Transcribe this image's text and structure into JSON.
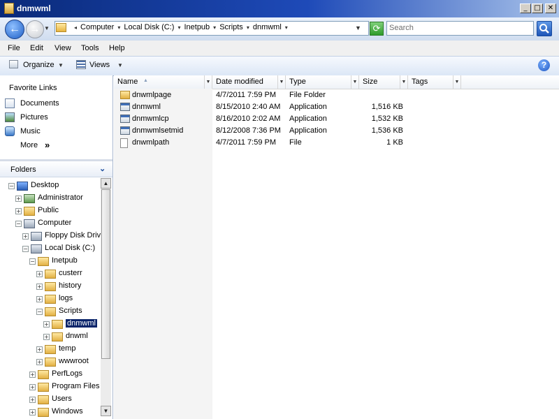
{
  "window": {
    "title": "dnmwml"
  },
  "address": {
    "crumbs": [
      "Computer",
      "Local Disk (C:)",
      "Inetpub",
      "Scripts",
      "dnmwml"
    ],
    "search_placeholder": "Search"
  },
  "menu": [
    "File",
    "Edit",
    "View",
    "Tools",
    "Help"
  ],
  "toolbar": {
    "organize": "Organize",
    "views": "Views"
  },
  "favorites": {
    "title": "Favorite Links",
    "items": [
      "Documents",
      "Pictures",
      "Music"
    ],
    "more": "More",
    "more_glyph": "»"
  },
  "folders": {
    "title": "Folders",
    "tree": [
      {
        "label": "Desktop",
        "depth": 0,
        "toggle": "−",
        "icon": "desktop"
      },
      {
        "label": "Administrator",
        "depth": 1,
        "toggle": "+",
        "icon": "user"
      },
      {
        "label": "Public",
        "depth": 1,
        "toggle": "+",
        "icon": "folder"
      },
      {
        "label": "Computer",
        "depth": 1,
        "toggle": "−",
        "icon": "computer"
      },
      {
        "label": "Floppy Disk Drive",
        "depth": 2,
        "toggle": "+",
        "icon": "floppy"
      },
      {
        "label": "Local Disk (C:)",
        "depth": 2,
        "toggle": "−",
        "icon": "disk"
      },
      {
        "label": "Inetpub",
        "depth": 3,
        "toggle": "−",
        "icon": "folder"
      },
      {
        "label": "custerr",
        "depth": 4,
        "toggle": "+",
        "icon": "folder"
      },
      {
        "label": "history",
        "depth": 4,
        "toggle": "+",
        "icon": "folder"
      },
      {
        "label": "logs",
        "depth": 4,
        "toggle": "+",
        "icon": "folder"
      },
      {
        "label": "Scripts",
        "depth": 4,
        "toggle": "−",
        "icon": "folder"
      },
      {
        "label": "dnmwml",
        "depth": 5,
        "toggle": "+",
        "icon": "folder",
        "selected": true
      },
      {
        "label": "dnwml",
        "depth": 5,
        "toggle": "+",
        "icon": "folder"
      },
      {
        "label": "temp",
        "depth": 4,
        "toggle": "+",
        "icon": "folder"
      },
      {
        "label": "wwwroot",
        "depth": 4,
        "toggle": "+",
        "icon": "folder"
      },
      {
        "label": "PerfLogs",
        "depth": 3,
        "toggle": "+",
        "icon": "folder"
      },
      {
        "label": "Program Files",
        "depth": 3,
        "toggle": "+",
        "icon": "folder"
      },
      {
        "label": "Users",
        "depth": 3,
        "toggle": "+",
        "icon": "folder"
      },
      {
        "label": "Windows",
        "depth": 3,
        "toggle": "+",
        "icon": "folder"
      }
    ]
  },
  "columns": [
    "Name",
    "Date modified",
    "Type",
    "Size",
    "Tags"
  ],
  "files": [
    {
      "name": "dnwmlpage",
      "date": "4/7/2011 7:59 PM",
      "type": "File Folder",
      "size": "",
      "icon": "folder"
    },
    {
      "name": "dnmwml",
      "date": "8/15/2010 2:40 AM",
      "type": "Application",
      "size": "1,516 KB",
      "icon": "app"
    },
    {
      "name": "dnmwmlcp",
      "date": "8/16/2010 2:02 AM",
      "type": "Application",
      "size": "1,532 KB",
      "icon": "app"
    },
    {
      "name": "dnmwmlsetmid",
      "date": "8/12/2008 7:36 PM",
      "type": "Application",
      "size": "1,536 KB",
      "icon": "app"
    },
    {
      "name": "dnwmlpath",
      "date": "4/7/2011 7:59 PM",
      "type": "File",
      "size": "1 KB",
      "icon": "file"
    }
  ],
  "colors": {
    "selection": "#0a246a",
    "title_start": "#0a2a7a",
    "title_end": "#a9c3ea"
  }
}
